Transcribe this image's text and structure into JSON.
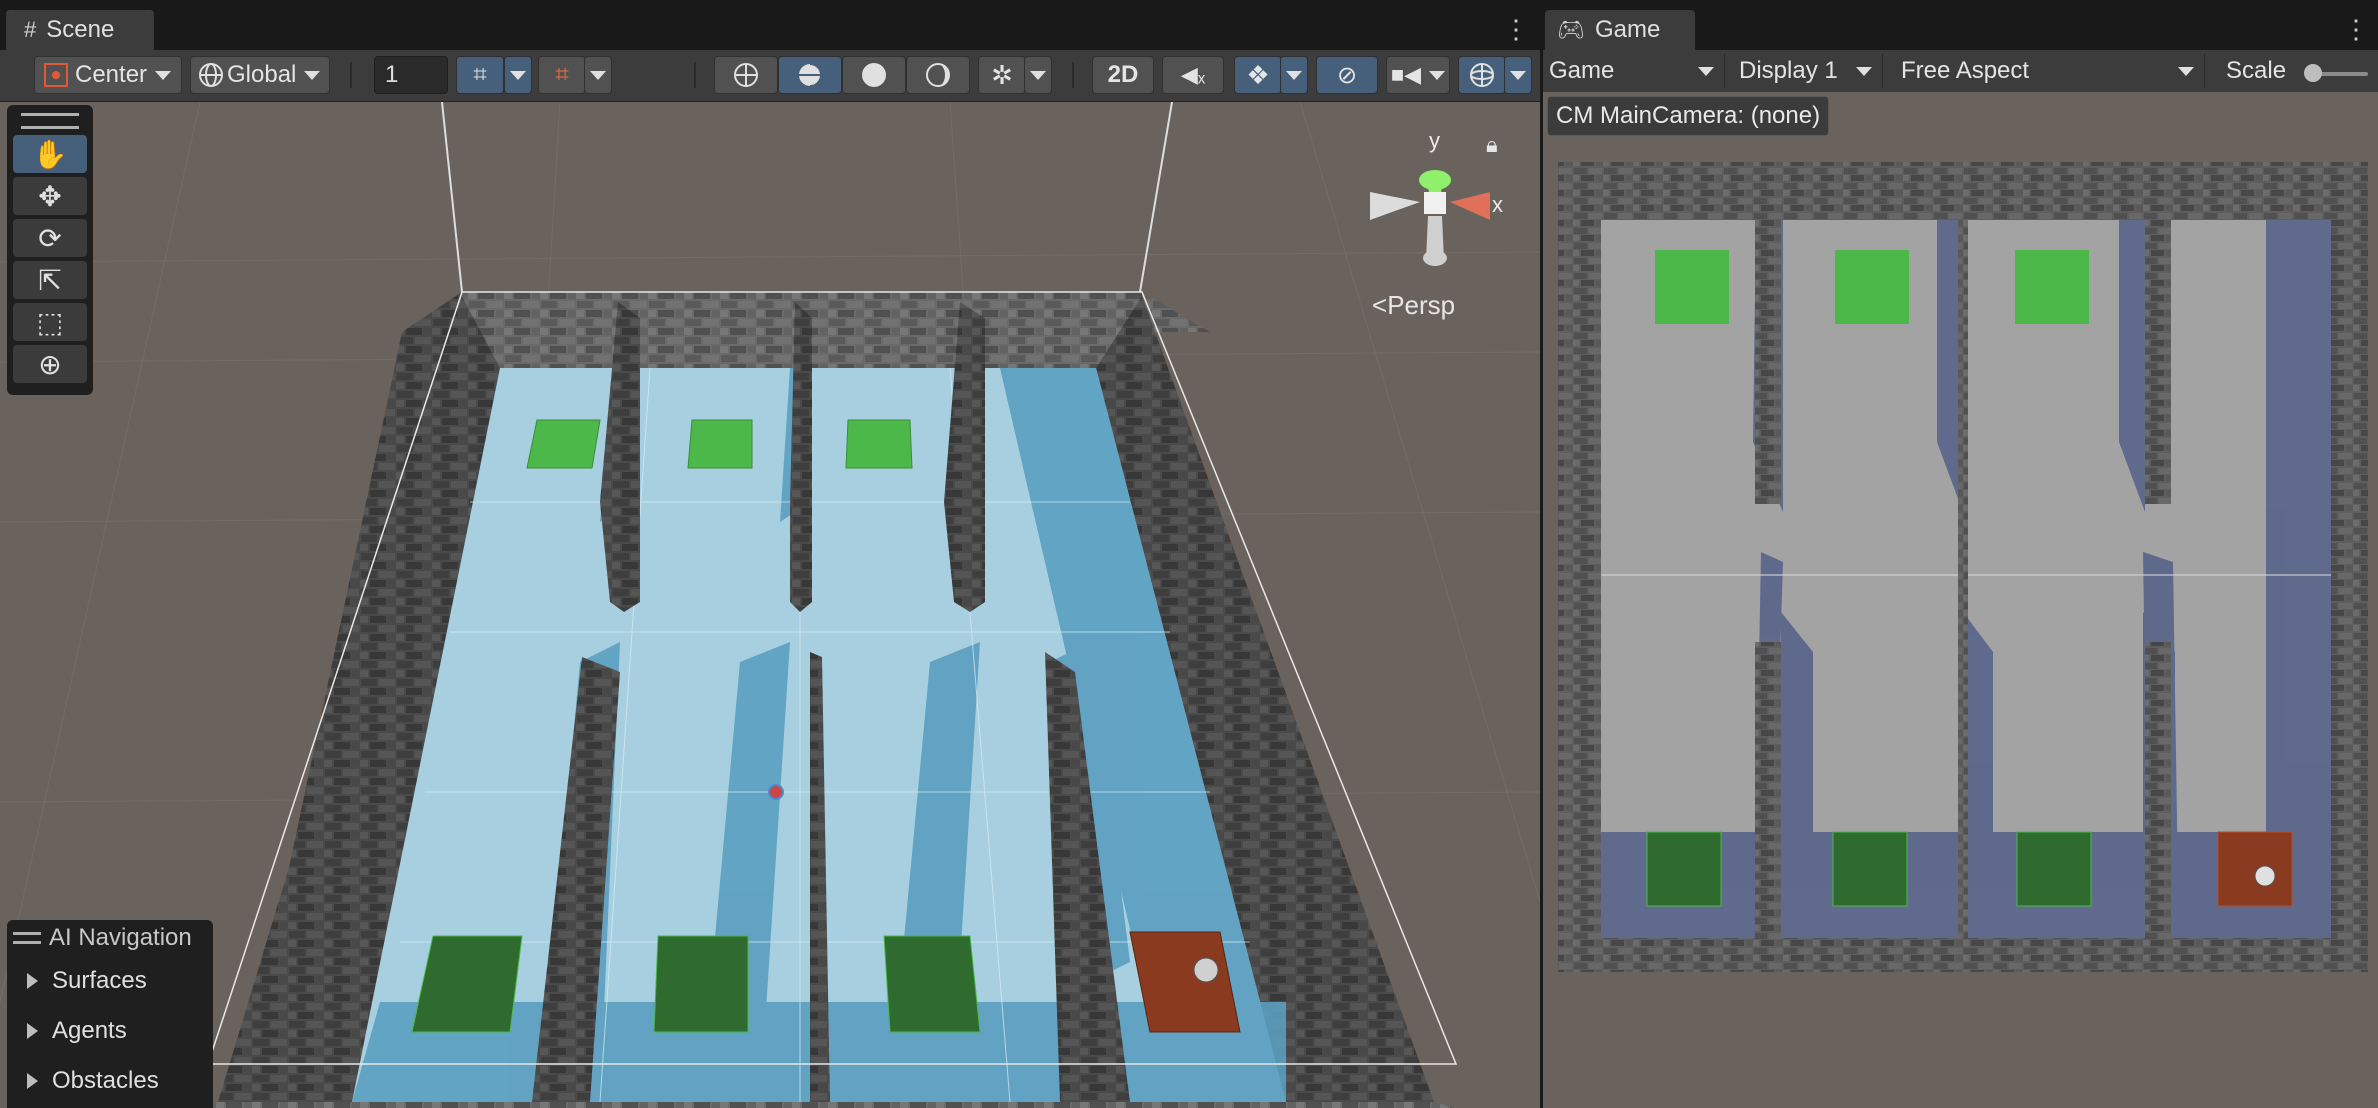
{
  "scene": {
    "tab_label": "Scene",
    "pivot_label": "Center",
    "space_label": "Global",
    "snap_value": "1",
    "mode_2d": "2D",
    "persp_label": "Persp",
    "gizmo_axis_y": "y",
    "gizmo_axis_x": "x",
    "tools": [
      "view-tool",
      "move-tool",
      "rotate-tool",
      "scale-tool",
      "rect-tool",
      "transform-tool"
    ],
    "active_tool": "view-tool"
  },
  "ai_navigation": {
    "title": "AI Navigation",
    "items": [
      {
        "label": "Surfaces"
      },
      {
        "label": "Agents"
      },
      {
        "label": "Obstacles"
      }
    ]
  },
  "game": {
    "tab_label": "Game",
    "view_select": "Game",
    "display_select": "Display 1",
    "aspect_select": "Free Aspect",
    "scale_label": "Scale",
    "camera_label": "CM MainCamera: (none)"
  },
  "colors": {
    "accent_active": "#46607c",
    "floor_blue": "#6fb6d6",
    "goal_green": "#4cb84a",
    "pad_dark_green": "#2f6a2f",
    "pad_red": "#8a3a1f"
  }
}
